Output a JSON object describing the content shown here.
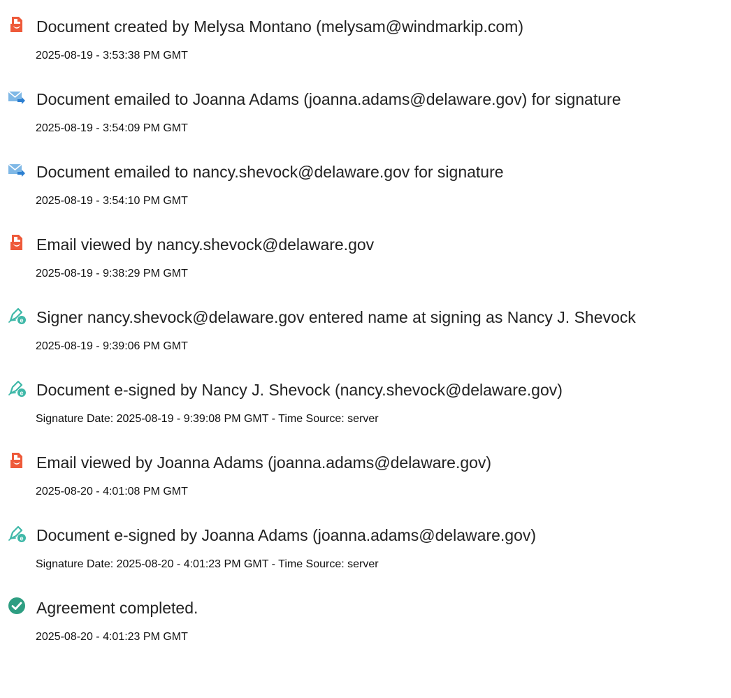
{
  "colors": {
    "document_icon": "#ee5a3a",
    "email_icon": "#7fb8e6",
    "email_arrow": "#2c7fd1",
    "signature_icon": "#3fb8a8",
    "completed_icon": "#2e9e82"
  },
  "events": [
    {
      "icon": "document-icon",
      "title": "Document created by Melysa Montano (melysam@windmarkip.com)",
      "detail": "2025-08-19 - 3:53:38 PM GMT"
    },
    {
      "icon": "email-sent-icon",
      "title": "Document emailed to Joanna Adams (joanna.adams@delaware.gov) for signature",
      "detail": "2025-08-19 - 3:54:09 PM GMT"
    },
    {
      "icon": "email-sent-icon",
      "title": "Document emailed to nancy.shevock@delaware.gov for signature",
      "detail": "2025-08-19 - 3:54:10 PM GMT"
    },
    {
      "icon": "document-icon",
      "title": "Email viewed by nancy.shevock@delaware.gov",
      "detail": "2025-08-19 - 9:38:29 PM GMT"
    },
    {
      "icon": "e-signature-icon",
      "title": "Signer nancy.shevock@delaware.gov entered name at signing as Nancy J. Shevock",
      "detail": "2025-08-19 - 9:39:06 PM GMT"
    },
    {
      "icon": "e-signature-icon",
      "title": "Document e-signed by Nancy J. Shevock (nancy.shevock@delaware.gov)",
      "detail": "Signature Date: 2025-08-19 - 9:39:08 PM GMT - Time Source: server"
    },
    {
      "icon": "document-icon",
      "title": "Email viewed by Joanna Adams (joanna.adams@delaware.gov)",
      "detail": "2025-08-20 - 4:01:08 PM GMT"
    },
    {
      "icon": "e-signature-icon",
      "title": "Document e-signed by Joanna Adams (joanna.adams@delaware.gov)",
      "detail": "Signature Date: 2025-08-20 - 4:01:23 PM GMT - Time Source: server"
    },
    {
      "icon": "completed-check-icon",
      "title": "Agreement completed.",
      "detail": "2025-08-20 - 4:01:23 PM GMT"
    }
  ]
}
